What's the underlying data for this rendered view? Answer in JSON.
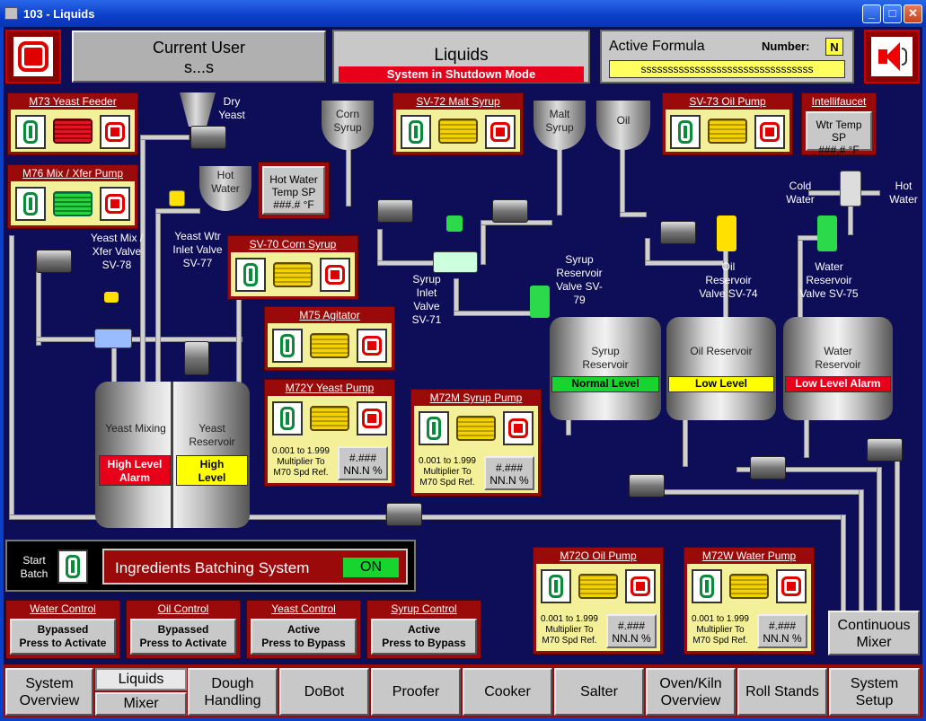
{
  "window": {
    "title": "103 - Liquids",
    "min": "_",
    "max": "□",
    "close": "✕"
  },
  "header": {
    "current_user_label": "Current User",
    "current_user": "s...s",
    "screen_title": "Liquids",
    "system_status": "System in Shutdown Mode",
    "active_formula_label": "Active Formula",
    "number_label": "Number:",
    "number_value": "N",
    "formula_value": "ssssssssssssssssssssssssssssssss"
  },
  "controls": {
    "m73": "M73 Yeast Feeder",
    "m76": "M76 Mix / Xfer Pump",
    "sv72": "SV-72 Malt Syrup",
    "sv73": "SV-73 Oil Pump",
    "intellifaucet": "Intellifaucet",
    "wtr_temp_sp": "Wtr Temp SP",
    "wtr_temp_val": "###.# °F",
    "hot_water_temp_sp": "Hot Water Temp SP",
    "hot_water_temp_val": "###.# °F",
    "sv70": "SV-70 Corn Syrup",
    "m75": "M75 Agitator",
    "m72y": "M72Y Yeast Pump",
    "m72m": "M72M Syrup Pump",
    "m72o": "M72O Oil Pump",
    "m72w": "M72W Water Pump",
    "multiplier_range": "0.001 to 1.999",
    "multiplier_text": "Multiplier To",
    "multiplier_ref": "M70 Spd Ref.",
    "mult_val": "#.###",
    "pct_val": "NN.N %"
  },
  "labels": {
    "dry_yeast": "Dry Yeast",
    "hot_water": "Hot Water",
    "corn_syrup": "Corn Syrup",
    "malt_syrup": "Malt Syrup",
    "oil": "Oil",
    "cold_water": "Cold Water",
    "hot_water_r": "Hot Water",
    "yeast_mix_valve": "Yeast Mix / Xfer Valve SV-78",
    "yeast_wtr_valve": "Yeast Wtr Inlet Valve SV-77",
    "syrup_inlet_valve": "Syrup Inlet Valve SV-71",
    "syrup_res_valve": "Syrup Reservoir Valve SV-79",
    "oil_res_valve": "Oil Reservoir Valve SV-74",
    "water_res_valve": "Water Reservoir Valve SV-75"
  },
  "tanks": {
    "yeast_mixing": "Yeast Mixing",
    "yeast_mixing_status": "High Level Alarm",
    "yeast_reservoir": "Yeast Reservoir",
    "yeast_reservoir_status": "High Level",
    "syrup": "Syrup Reservoir",
    "syrup_status": "Normal Level",
    "oil": "Oil Reservoir",
    "oil_status": "Low Level",
    "water": "Water Reservoir",
    "water_status": "Low Level Alarm"
  },
  "batching": {
    "start_batch": "Start Batch",
    "title": "Ingredients Batching System",
    "state": "ON"
  },
  "control_modes": [
    {
      "title": "Water Control",
      "state": "Bypassed",
      "action": "Press to Activate"
    },
    {
      "title": "Oil Control",
      "state": "Bypassed",
      "action": "Press to Activate"
    },
    {
      "title": "Yeast Control",
      "state": "Active",
      "action": "Press to Bypass"
    },
    {
      "title": "Syrup Control",
      "state": "Active",
      "action": "Press to Bypass"
    }
  ],
  "continuous_mixer": "Continuous Mixer",
  "nav": {
    "system_overview": "System Overview",
    "liquids": "Liquids",
    "mixer": "Mixer",
    "dough_handling": "Dough Handling",
    "dobot": "DoBot",
    "proofer": "Proofer",
    "cooker": "Cooker",
    "salter": "Salter",
    "oven_kiln": "Oven/Kiln Overview",
    "roll_stands": "Roll Stands",
    "system_setup": "System Setup"
  },
  "colors": {
    "alarm": "#e8001a",
    "warn": "#ffff00",
    "ok": "#17d42e",
    "bg": "#0d0d58"
  }
}
